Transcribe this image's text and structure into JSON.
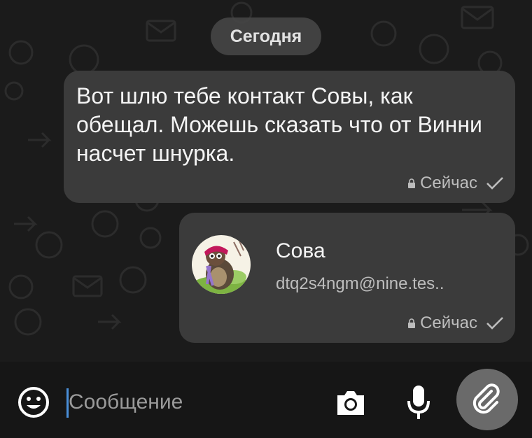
{
  "chat": {
    "date_label": "Сегодня",
    "messages": [
      {
        "type": "text",
        "text": "Вот шлю тебе контакт Совы, как обещал. Можешь сказать что от Винни насчет шнурка.",
        "time": "Сейчас",
        "status_icon": "check-icon"
      },
      {
        "type": "contact",
        "contact_name": "Сова",
        "contact_email": "dtq2s4ngm@nine.tes..",
        "time": "Сейчас",
        "status_icon": "check-icon"
      }
    ]
  },
  "composer": {
    "placeholder": "Сообщение",
    "value": "",
    "icons": [
      "emoji-icon",
      "camera-icon",
      "microphone-icon",
      "paperclip-icon"
    ]
  },
  "colors": {
    "background": "#1b1b1b",
    "bubble": "#3b3b3b",
    "date_pill": "#484848",
    "attach_button": "#6a6a6a",
    "cursor": "#4a8fd9"
  }
}
